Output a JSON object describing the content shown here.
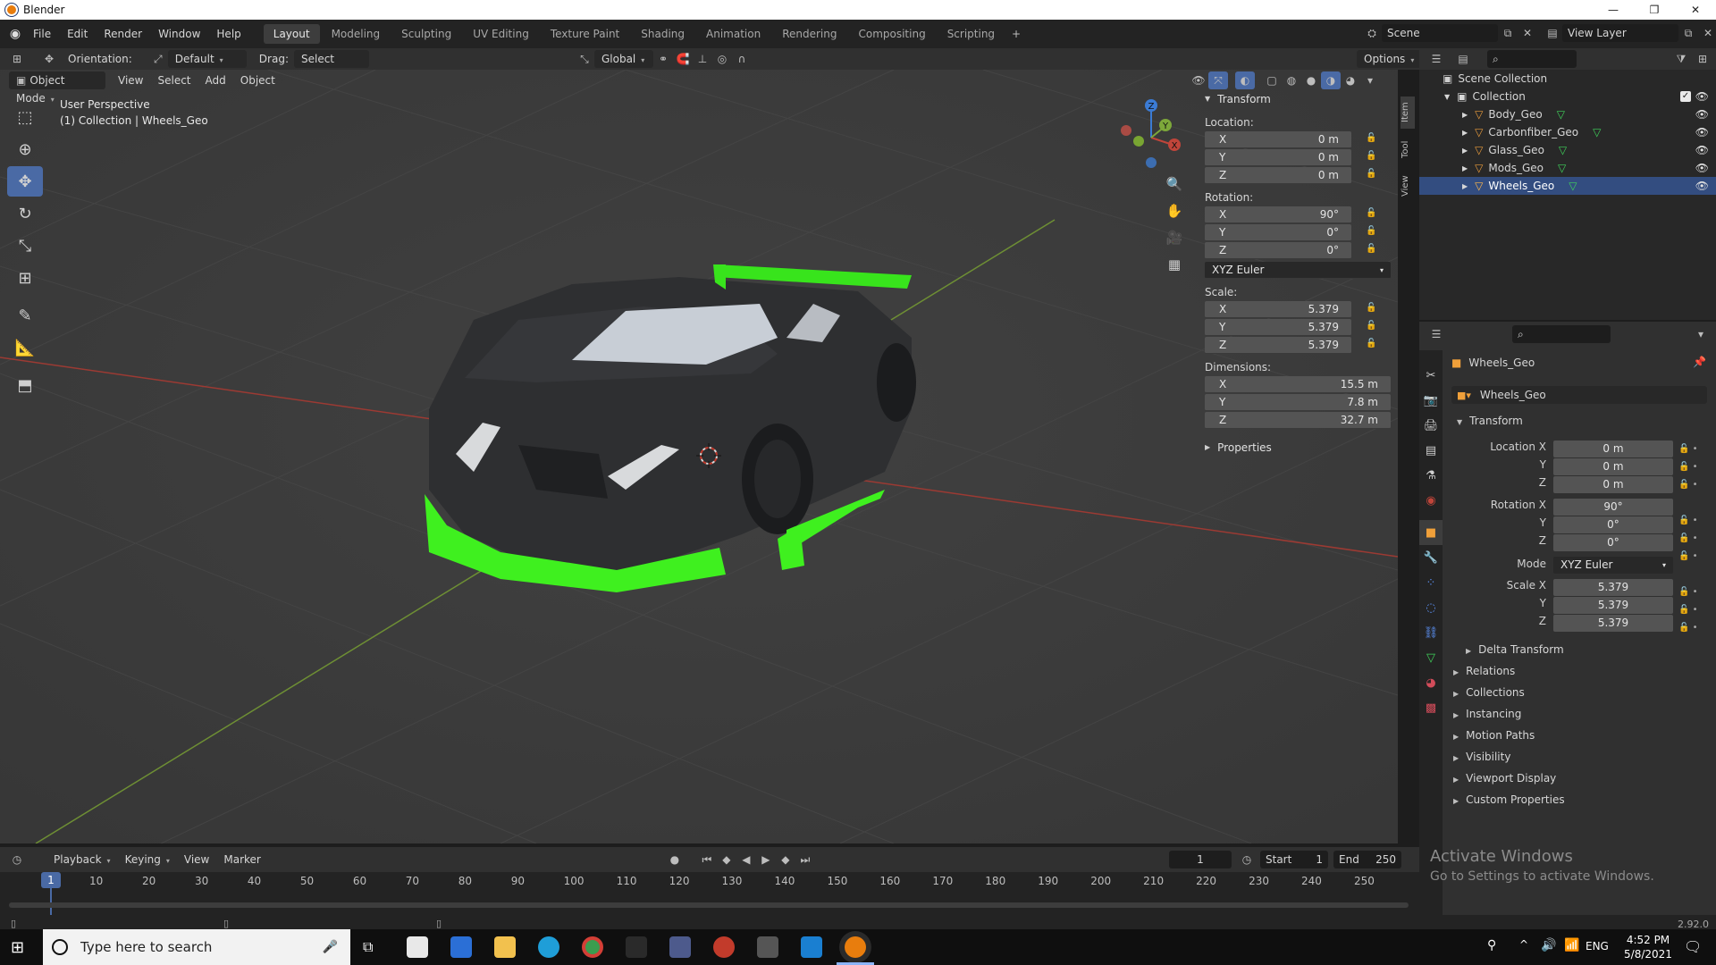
{
  "window": {
    "title": "Blender",
    "controls": [
      "—",
      "❐",
      "✕"
    ]
  },
  "menu": [
    "File",
    "Edit",
    "Render",
    "Window",
    "Help"
  ],
  "workspaces": [
    "Layout",
    "Modeling",
    "Sculpting",
    "UV Editing",
    "Texture Paint",
    "Shading",
    "Animation",
    "Rendering",
    "Compositing",
    "Scripting"
  ],
  "active_workspace": "Layout",
  "scene": {
    "label": "Scene",
    "view_layer": "View Layer"
  },
  "tool_header": {
    "orientation_label": "Orientation:",
    "orientation_value": "Default",
    "drag_label": "Drag:",
    "drag_value": "Select Box",
    "transform_orientation": "Global",
    "options": "Options"
  },
  "viewport_header": {
    "mode": "Object Mode",
    "menus": [
      "View",
      "Select",
      "Add",
      "Object"
    ]
  },
  "viewport_info": {
    "line1": "User Perspective",
    "line2": "(1) Collection | Wheels_Geo"
  },
  "gizmo_axes": [
    "Z",
    "Y",
    "X"
  ],
  "n_panel": {
    "tabs": [
      "Item",
      "Tool",
      "View"
    ],
    "transform_title": "Transform",
    "location_label": "Location:",
    "location": [
      {
        "axis": "X",
        "value": "0 m"
      },
      {
        "axis": "Y",
        "value": "0 m"
      },
      {
        "axis": "Z",
        "value": "0 m"
      }
    ],
    "rotation_label": "Rotation:",
    "rotation": [
      {
        "axis": "X",
        "value": "90°"
      },
      {
        "axis": "Y",
        "value": "0°"
      },
      {
        "axis": "Z",
        "value": "0°"
      }
    ],
    "rotation_mode": "XYZ Euler",
    "scale_label": "Scale:",
    "scale": [
      {
        "axis": "X",
        "value": "5.379"
      },
      {
        "axis": "Y",
        "value": "5.379"
      },
      {
        "axis": "Z",
        "value": "5.379"
      }
    ],
    "dimensions_label": "Dimensions:",
    "dimensions": [
      {
        "axis": "X",
        "value": "15.5 m"
      },
      {
        "axis": "Y",
        "value": "7.8 m"
      },
      {
        "axis": "Z",
        "value": "32.7 m"
      }
    ],
    "properties_title": "Properties"
  },
  "outliner": {
    "root": "Scene Collection",
    "collection": "Collection",
    "objects": [
      "Body_Geo",
      "Carbonfiber_Geo",
      "Glass_Geo",
      "Mods_Geo",
      "Wheels_Geo"
    ]
  },
  "properties": {
    "object_name": "Wheels_Geo",
    "object_field": "Wheels_Geo",
    "transform_title": "Transform",
    "location_labels": [
      "Location X",
      "Y",
      "Z"
    ],
    "location_values": [
      "0 m",
      "0 m",
      "0 m"
    ],
    "rotation_labels": [
      "Rotation X",
      "Y",
      "Z"
    ],
    "rotation_values": [
      "90°",
      "0°",
      "0°"
    ],
    "mode_label": "Mode",
    "mode_value": "XYZ Euler",
    "scale_labels": [
      "Scale X",
      "Y",
      "Z"
    ],
    "scale_values": [
      "5.379",
      "5.379",
      "5.379"
    ],
    "delta": "Delta Transform",
    "sections": [
      "Relations",
      "Collections",
      "Instancing",
      "Motion Paths",
      "Visibility",
      "Viewport Display",
      "Custom Properties"
    ]
  },
  "timeline": {
    "menus": [
      "Playback",
      "Keying",
      "View",
      "Marker"
    ],
    "current_frame": "1",
    "start_label": "Start",
    "start": "1",
    "end_label": "End",
    "end": "250",
    "ticks": [
      "1",
      "10",
      "20",
      "30",
      "40",
      "50",
      "60",
      "70",
      "80",
      "90",
      "100",
      "110",
      "120",
      "130",
      "140",
      "150",
      "160",
      "170",
      "180",
      "190",
      "200",
      "210",
      "220",
      "230",
      "240",
      "250"
    ]
  },
  "watermark": {
    "line1": "Activate Windows",
    "line2": "Go to Settings to activate Windows."
  },
  "version": "2.92.0",
  "taskbar": {
    "search_placeholder": "Type here to search",
    "lang": "ENG",
    "time": "4:52 PM",
    "date": "5/8/2021"
  },
  "colors": {
    "accent": "#4a6aa5",
    "selected_green": "#39ff14",
    "axis_red": "#c0453a",
    "axis_green": "#7da83a",
    "viewport_bg": "#3d3d3d"
  }
}
